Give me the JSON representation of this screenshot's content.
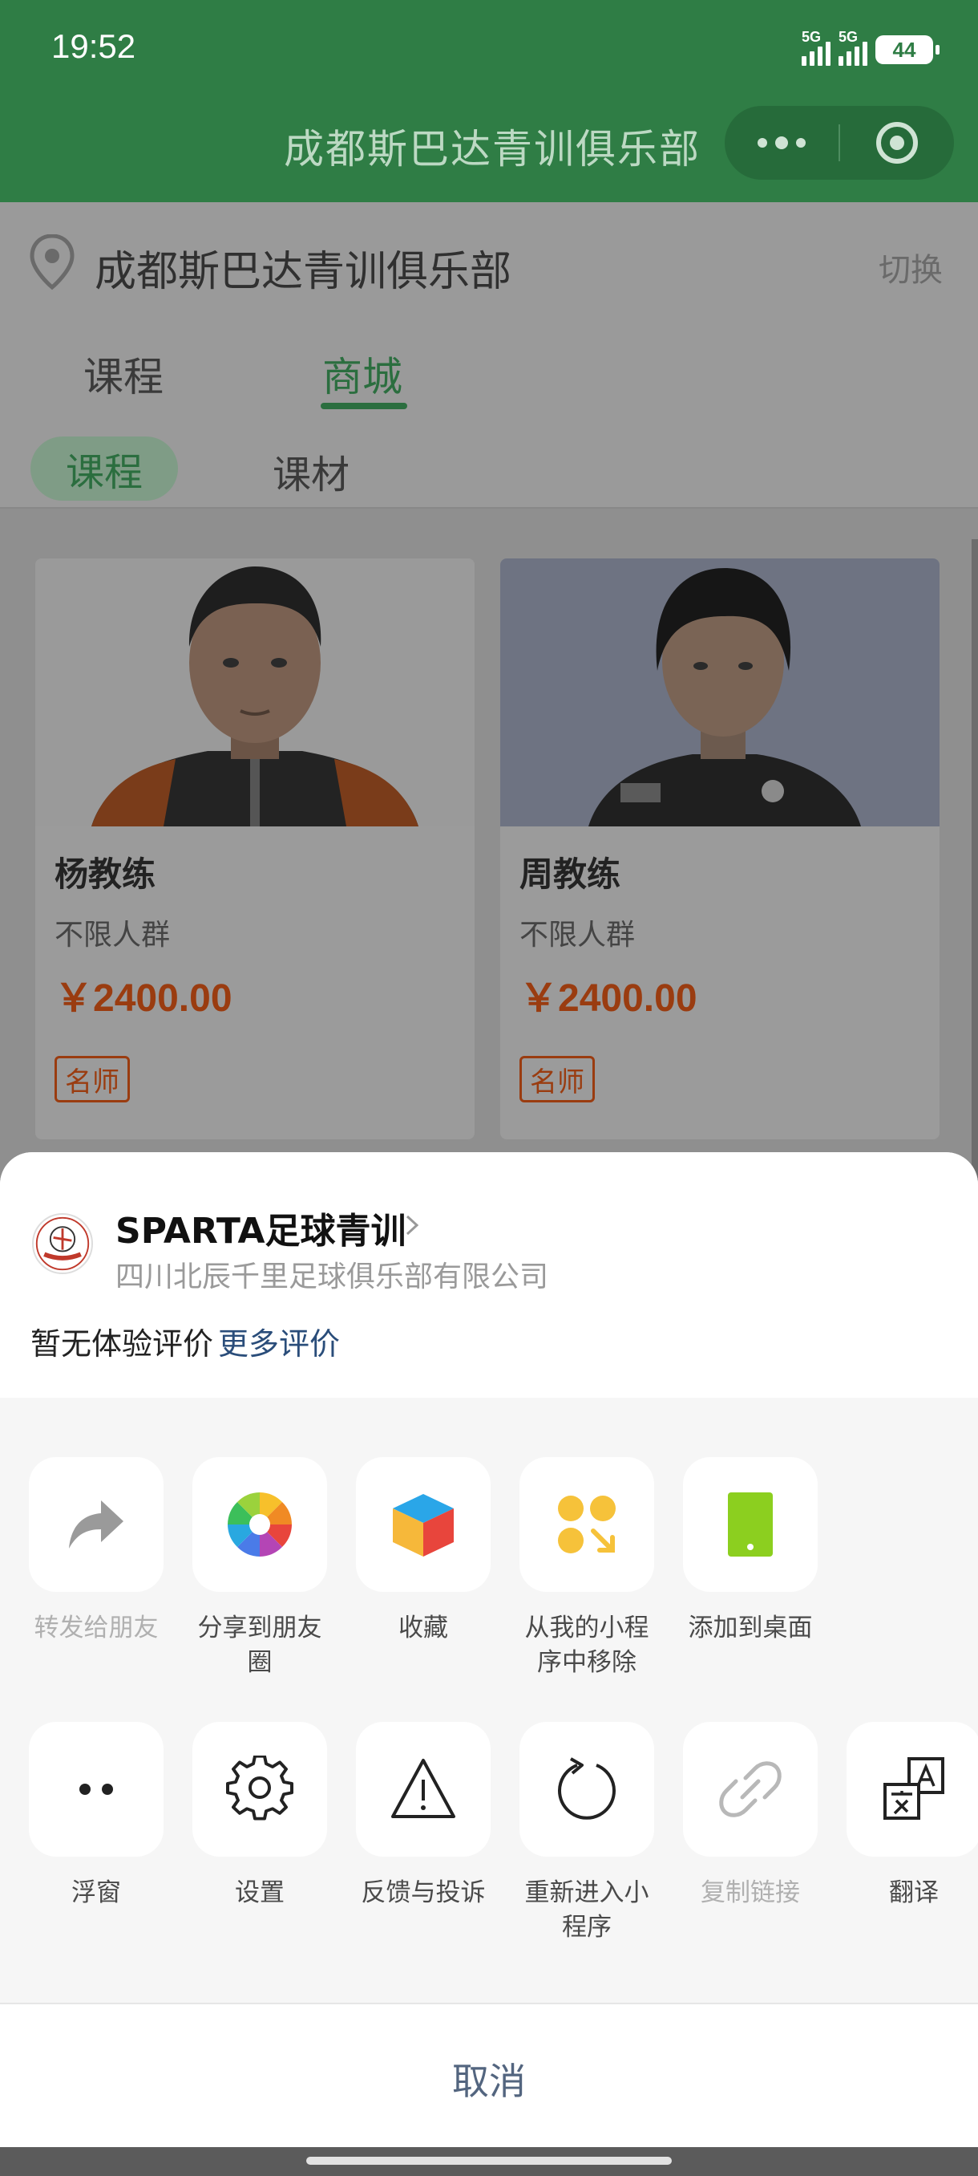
{
  "status_bar": {
    "time": "19:52",
    "net1": "5G",
    "net2": "5G",
    "battery": "44"
  },
  "nav": {
    "title": "成都斯巴达青训俱乐部"
  },
  "location": {
    "name": "成都斯巴达青训俱乐部",
    "switch_label": "切换"
  },
  "tabs": [
    {
      "label": "课程"
    },
    {
      "label": "商城"
    }
  ],
  "sub_tabs": [
    {
      "label": "课程"
    },
    {
      "label": "课材"
    }
  ],
  "cards": [
    {
      "name": "杨教练",
      "group": "不限人群",
      "price": "￥2400.00",
      "tag": "名师"
    },
    {
      "name": "周教练",
      "group": "不限人群",
      "price": "￥2400.00",
      "tag": "名师"
    }
  ],
  "sheet": {
    "app_name": "SPARTA足球青训",
    "company": "四川北辰千里足球俱乐部有限公司",
    "review_text": "暂无体验评价",
    "review_link": "更多评价",
    "logo_text": "SPARTA",
    "row1": [
      {
        "label": "转发给朋友",
        "icon": "forward-icon"
      },
      {
        "label": "分享到朋友圈",
        "icon": "moments-icon"
      },
      {
        "label": "收藏",
        "icon": "favorite-cube-icon"
      },
      {
        "label": "从我的小程序中移除",
        "icon": "remove-miniprogram-icon"
      },
      {
        "label": "添加到桌面",
        "icon": "add-to-desktop-icon"
      }
    ],
    "row2": [
      {
        "label": "浮窗",
        "icon": "float-window-icon"
      },
      {
        "label": "设置",
        "icon": "gear-icon"
      },
      {
        "label": "反馈与投诉",
        "icon": "warning-icon"
      },
      {
        "label": "重新进入小程序",
        "icon": "reload-icon"
      },
      {
        "label": "复制链接",
        "icon": "link-icon"
      },
      {
        "label": "翻译",
        "icon": "translate-icon"
      }
    ],
    "cancel": "取消"
  },
  "colors": {
    "nav_green": "#2f7d45",
    "accent_green": "#2b6e3f",
    "price_orange": "#e05a1c",
    "link_blue": "#2a4d7a"
  }
}
